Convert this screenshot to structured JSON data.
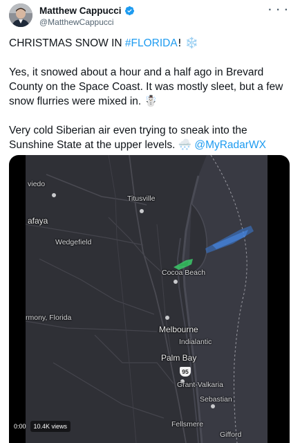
{
  "author": {
    "display_name": "Matthew Cappucci",
    "handle": "@MatthewCappucci",
    "verified_icon": "verified-badge-icon",
    "avatar_icon": "avatar-photo"
  },
  "more_icon": "more-options-icon",
  "tweet": {
    "p1_prefix": "CHRISTMAS SNOW IN ",
    "p1_hashtag": "#FLORIDA",
    "p1_suffix": "! ❄️",
    "p2": "Yes, it snowed about a hour and a half ago in Brevard County on the Space Coast. It was mostly sleet, but a few snow flurries were mixed in. ☃️",
    "p3_prefix": "Very cold Siberian air even trying to sneak into the Sunshine State at the upper levels. 🌨️ ",
    "p3_mention": "@MyRadarWX"
  },
  "media": {
    "type": "video",
    "elapsed": "0:00",
    "views": "10.4K views",
    "map_labels": {
      "oviedo": "viedo",
      "titusville": "Titusville",
      "lafayette": "afaya",
      "wedgefield": "Wedgefield",
      "cocoa_beach": "Cocoa Beach",
      "harmony": "rmony, Florida",
      "melbourne": "Melbourne",
      "indialantic": "Indialantic",
      "palm_bay": "Palm Bay",
      "interstate": "95",
      "grant_valkaria": "Grant-Valkaria",
      "sebastian": "Sebastian",
      "fellsmere": "Fellsmere",
      "gifford": "Gifford"
    },
    "colors": {
      "land": "#2f3036",
      "ocean": "#3a3b44",
      "radar_blue": "#3b7bd8",
      "radar_green": "#3cc86a"
    }
  }
}
